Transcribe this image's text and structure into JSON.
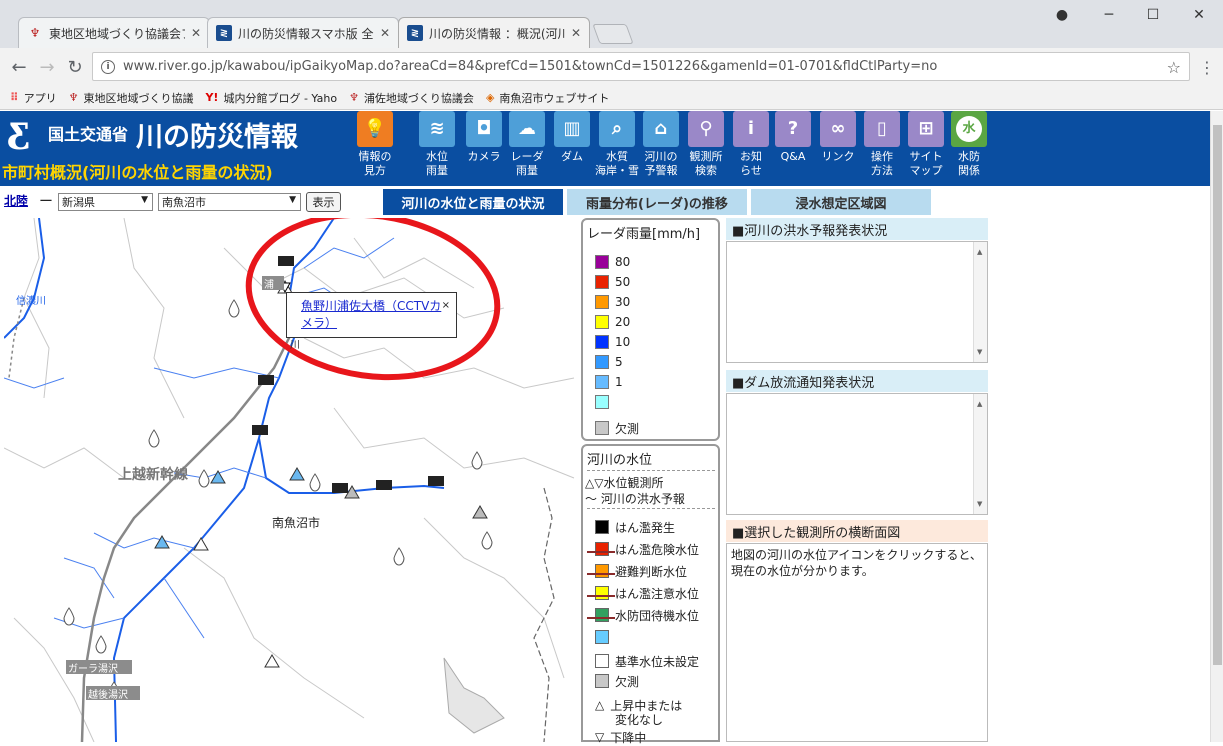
{
  "browser": {
    "tabs": [
      {
        "title": "東地区地域づくり協議会ブ",
        "favicon": "red"
      },
      {
        "title": "川の防災情報スマホ版 全国",
        "favicon": "blue"
      },
      {
        "title": "川の防災情報 ：概況(河川",
        "favicon": "blue"
      }
    ],
    "url": "www.river.go.jp/kawabou/ipGaikyoMap.do?areaCd=84&prefCd=1501&townCd=1501226&gamenId=01-0701&fldCtlParty=no",
    "bookmarks": [
      "アプリ",
      "東地区地域づくり協議",
      "城内分館ブログ - Yaho",
      "浦佐地域づくり協議会",
      "南魚沼市ウェブサイト"
    ]
  },
  "site": {
    "ministry": "国土交通省",
    "title": "川の防災情報",
    "page_title": "市町村概況(河川の水位と雨量の状況)",
    "menu": [
      {
        "l1": "情報の",
        "l2": "見方",
        "icon": "lightbulb-icon",
        "glyph": "💡"
      },
      {
        "l1": "水位",
        "l2": "雨量",
        "icon": "water-level-icon",
        "glyph": "≋"
      },
      {
        "l1": "カメラ",
        "l2": "",
        "icon": "camera-icon",
        "glyph": "◘"
      },
      {
        "l1": "レーダ",
        "l2": "雨量",
        "icon": "radar-rain-icon",
        "glyph": "☁"
      },
      {
        "l1": "ダム",
        "l2": "",
        "icon": "dam-icon",
        "glyph": "▥"
      },
      {
        "l1": "水質",
        "l2": "海岸・雪",
        "icon": "water-quality-icon",
        "glyph": "⌕"
      },
      {
        "l1": "河川の",
        "l2": "予警報",
        "icon": "warning-house-icon",
        "glyph": "⌂"
      },
      {
        "l1": "観測所",
        "l2": "検索",
        "icon": "search-icon",
        "glyph": "⚲"
      },
      {
        "l1": "お知",
        "l2": "らせ",
        "icon": "info-icon",
        "glyph": "i"
      },
      {
        "l1": "Q&A",
        "l2": "",
        "icon": "question-icon",
        "glyph": "?"
      },
      {
        "l1": "リンク",
        "l2": "",
        "icon": "link-icon",
        "glyph": "∞"
      },
      {
        "l1": "操作",
        "l2": "方法",
        "icon": "mouse-icon",
        "glyph": "▯"
      },
      {
        "l1": "サイト",
        "l2": "マップ",
        "icon": "sitemap-icon",
        "glyph": "⊞"
      },
      {
        "l1": "水防",
        "l2": "関係",
        "icon": "flood-defense-icon",
        "glyph": "水"
      }
    ]
  },
  "selector": {
    "region": "北陸",
    "dash": "ー",
    "prefecture": "新潟県",
    "city": "南魚沼市",
    "show_label": "表示",
    "tabs": [
      "河川の水位と雨量の状況",
      "雨量分布(レーダ)の推移",
      "浸水想定区域図"
    ]
  },
  "map": {
    "labels": {
      "shinano": "信濃川",
      "joetsu": "上越新幹線",
      "minamiuonuma": "南魚沼市",
      "gala": "ガーラ湯沢",
      "echigo": "越後湯沢",
      "urasa_tag": "浦",
      "river_small": "川"
    },
    "popup_link": "魚野川浦佐大橋（CCTVカメラ）",
    "popup_close": "×"
  },
  "legend_rain": {
    "title": "レーダ雨量[mm/h]",
    "items": [
      {
        "label": "80",
        "color": "#990099"
      },
      {
        "label": "50",
        "color": "#e82200"
      },
      {
        "label": "30",
        "color": "#ff9900"
      },
      {
        "label": "20",
        "color": "#ffff00"
      },
      {
        "label": "10",
        "color": "#0033ff"
      },
      {
        "label": "5",
        "color": "#3399ff"
      },
      {
        "label": "1",
        "color": "#66bbff"
      },
      {
        "label": "",
        "color": "#99ffff"
      },
      {
        "label": "欠測",
        "color": "#c8c8c8"
      }
    ]
  },
  "legend_river": {
    "title": "河川の水位",
    "station": "△▽水位観測所",
    "forecast": "〜 河川の洪水予報",
    "items": [
      {
        "label": "はん濫発生",
        "color": "#000000"
      },
      {
        "label": "はん濫危険水位",
        "color": "#e82200"
      },
      {
        "label": "避難判断水位",
        "color": "#ff9900"
      },
      {
        "label": "はん濫注意水位",
        "color": "#ffff00"
      },
      {
        "label": "水防団待機水位",
        "color": "#33a060"
      },
      {
        "label": "",
        "color": "#66ccff"
      }
    ],
    "unset": "基準水位未設定",
    "missing": "欠測",
    "rising1": "上昇中または",
    "rising2": "変化なし",
    "falling": "下降中"
  },
  "panels": {
    "flood_forecast": "■河川の洪水予報発表状況",
    "dam_release": "■ダム放流通知発表状況",
    "cross_section": "■選択した観測所の横断面図",
    "cross_section_msg": "地図の河川の水位アイコンをクリックすると、現在の水位が分かります。"
  }
}
